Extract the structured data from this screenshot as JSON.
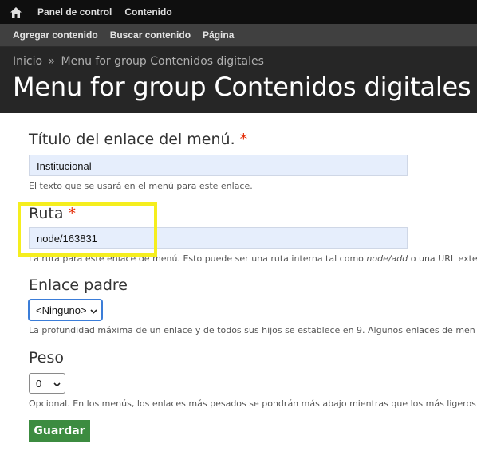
{
  "toolbar": {
    "home_icon": "home-icon",
    "items": [
      "Panel de control",
      "Contenido"
    ]
  },
  "tray": {
    "items": [
      "Agregar contenido",
      "Buscar contenido",
      "Página"
    ]
  },
  "header": {
    "breadcrumb_home": "Inicio",
    "breadcrumb_separator": "»",
    "breadcrumb_current": "Menu for group Contenidos digitales",
    "title": "Menu for group Contenidos digitales"
  },
  "form": {
    "title_label": "Título del enlace del menú.",
    "required_marker": "*",
    "title_value": "Institucional",
    "title_desc": "El texto que se usará en el menú para este enlace.",
    "path_label": "Ruta",
    "path_value": "node/163831",
    "path_desc_before": "La ruta para este enlace de menú. Esto puede ser una ruta interna tal como ",
    "path_desc_example": "node/add",
    "path_desc_after": " o una URL exte",
    "parent_label": "Enlace padre",
    "parent_value": "<Ninguno>",
    "parent_desc": "La profundidad máxima de un enlace y de todos sus hijos se establece en 9. Algunos enlaces de men",
    "weight_label": "Peso",
    "weight_value": "0",
    "weight_desc": "Opcional. En los menús, los enlaces más pesados se pondrán más abajo mientras que los más ligeros",
    "save_label": "Guardar"
  },
  "colors": {
    "accent_green": "#3c8c40",
    "highlight_yellow": "#f5ee1e",
    "required_red": "#e32700"
  }
}
